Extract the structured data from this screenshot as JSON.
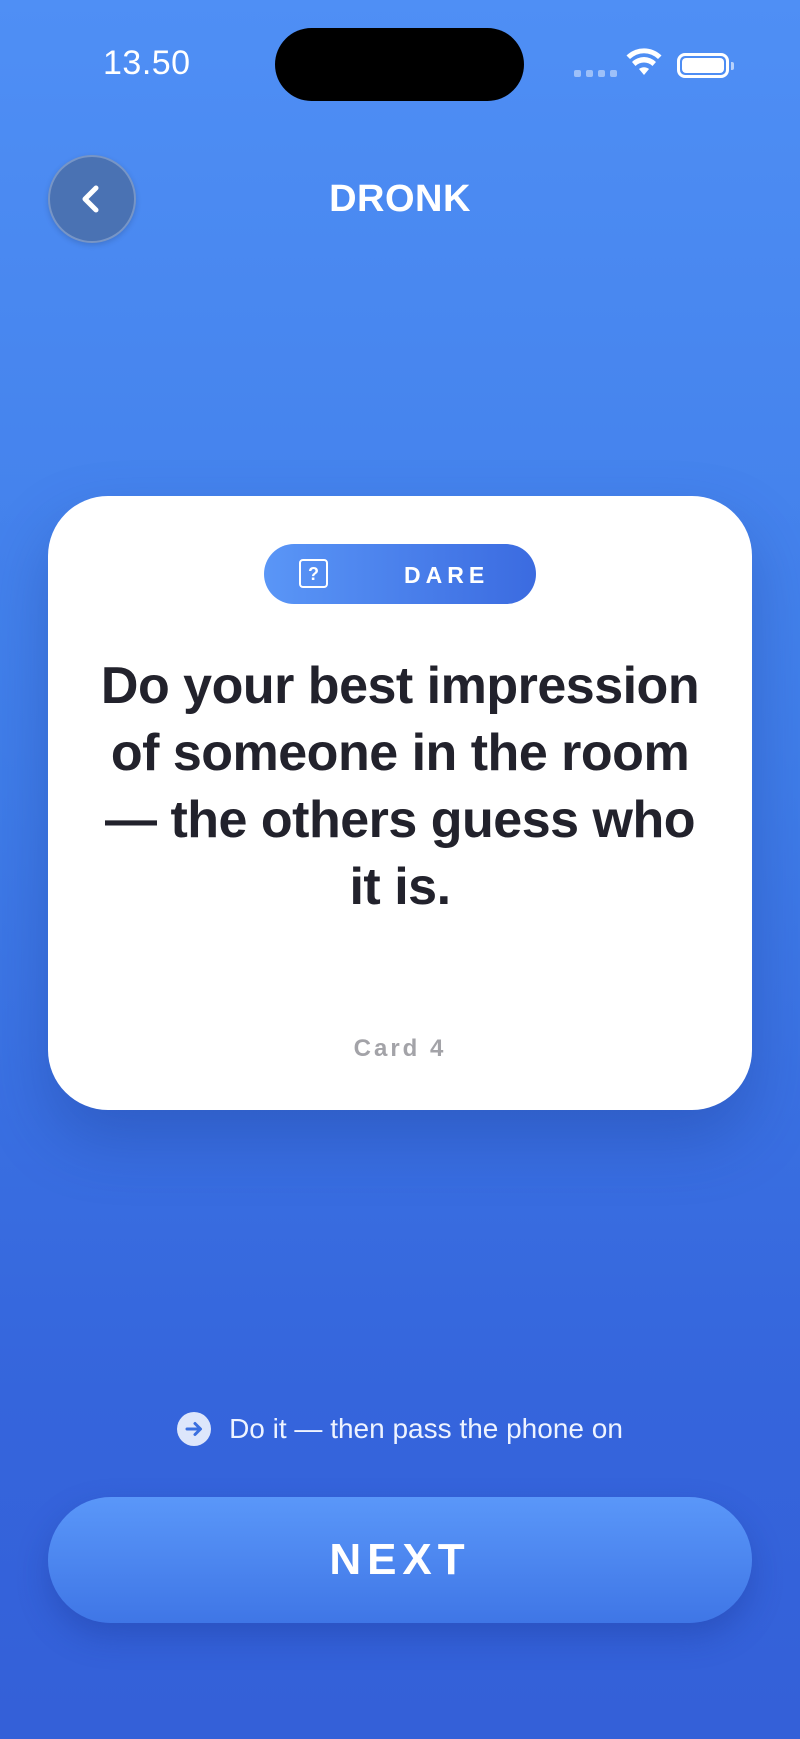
{
  "status_bar": {
    "time": "13.50",
    "icons": [
      "signal-dots-icon",
      "wifi-icon",
      "battery-icon"
    ]
  },
  "header": {
    "back_icon": "chevron-left-icon",
    "title": "DRONK"
  },
  "card": {
    "badge": {
      "icon": "question-square-icon",
      "label": "DARE"
    },
    "text": "Do your best impression of someone in the room — the others guess who it is.",
    "number": "Card 4"
  },
  "hint": {
    "icon": "arrow-right-circle-icon",
    "text": "Do it — then pass the phone on"
  },
  "next_button": {
    "label": "NEXT"
  },
  "colors": {
    "background_top": "#4f8ff5",
    "background_bottom": "#3460d8",
    "card_text": "#22222c",
    "card_number": "#a3a3a8",
    "back_button": "#4a72b3"
  }
}
